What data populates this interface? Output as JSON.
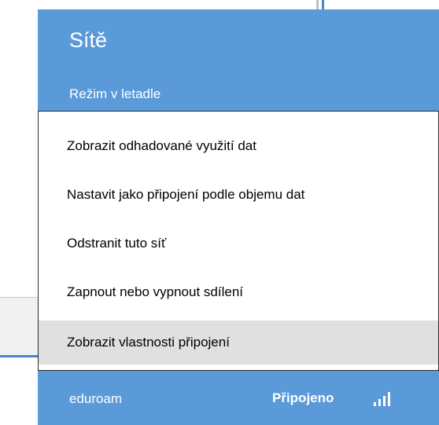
{
  "panel": {
    "title": "Sítě",
    "airplane_mode_label": "Režim v letadle",
    "background_color": "#5a9ad9"
  },
  "context_menu": {
    "items": [
      {
        "label": "Zobrazit odhadované využití dat"
      },
      {
        "label": "Nastavit jako připojení podle objemu dat"
      },
      {
        "label": "Odstranit tuto síť"
      },
      {
        "label": "Zapnout nebo vypnout sdílení"
      },
      {
        "label": "Zobrazit vlastnosti připojení",
        "highlighted": true
      }
    ]
  },
  "network": {
    "name": "eduroam",
    "status": "Připojeno",
    "signal_icon": "wifi-signal-icon"
  }
}
